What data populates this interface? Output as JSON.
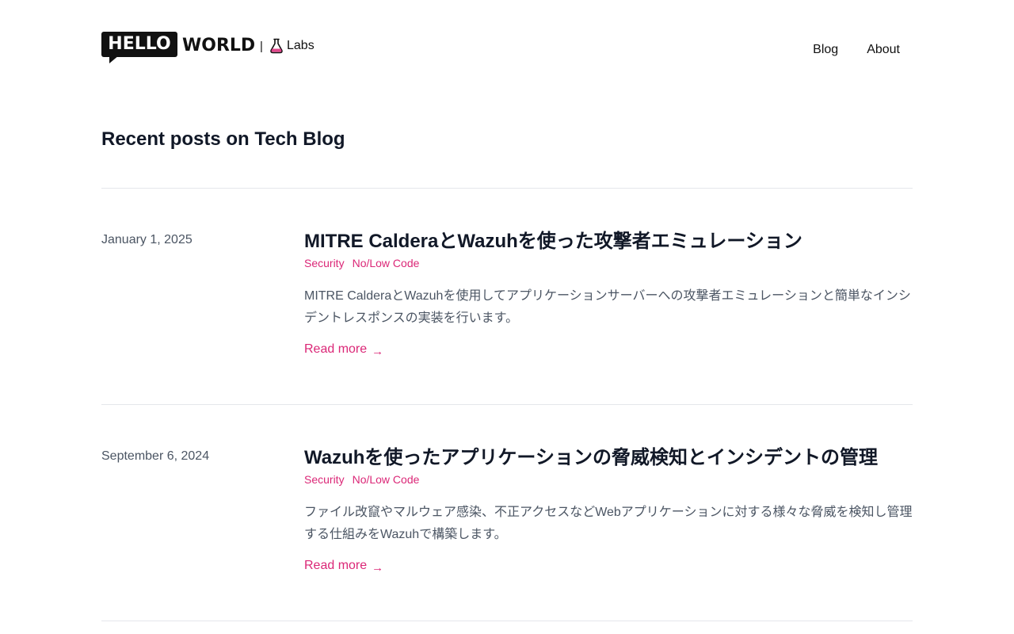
{
  "header": {
    "logo_hello": "HELLO",
    "logo_world": "WORLD",
    "separator": "|",
    "labs_label": "Labs",
    "labs_icon": "flask-icon",
    "nav": [
      {
        "label": "Blog"
      },
      {
        "label": "About"
      }
    ]
  },
  "main": {
    "section_title": "Recent posts on Tech Blog",
    "posts": [
      {
        "date": "January 1, 2025",
        "title": "MITRE CalderaとWazuhを使った攻撃者エミュレーション",
        "tags": [
          "Security",
          "No/Low Code"
        ],
        "summary": "MITRE CalderaとWazuhを使用してアプリケーションサーバーへの攻撃者エミュレーションと簡単なインシデントレスポンスの実装を行います。",
        "read_more": "Read more",
        "arrow": "→"
      },
      {
        "date": "September 6, 2024",
        "title": "Wazuhを使ったアプリケーションの脅威検知とインシデントの管理",
        "tags": [
          "Security",
          "No/Low Code"
        ],
        "summary": "ファイル改竄やマルウェア感染、不正アクセスなどWebアプリケーションに対する様々な脅威を検知し管理する仕組みをWazuhで構築します。",
        "read_more": "Read more",
        "arrow": "→"
      }
    ]
  },
  "colors": {
    "accent": "#db2777",
    "heading": "#111827",
    "muted": "#4b5563",
    "divider": "#e5e7eb"
  }
}
